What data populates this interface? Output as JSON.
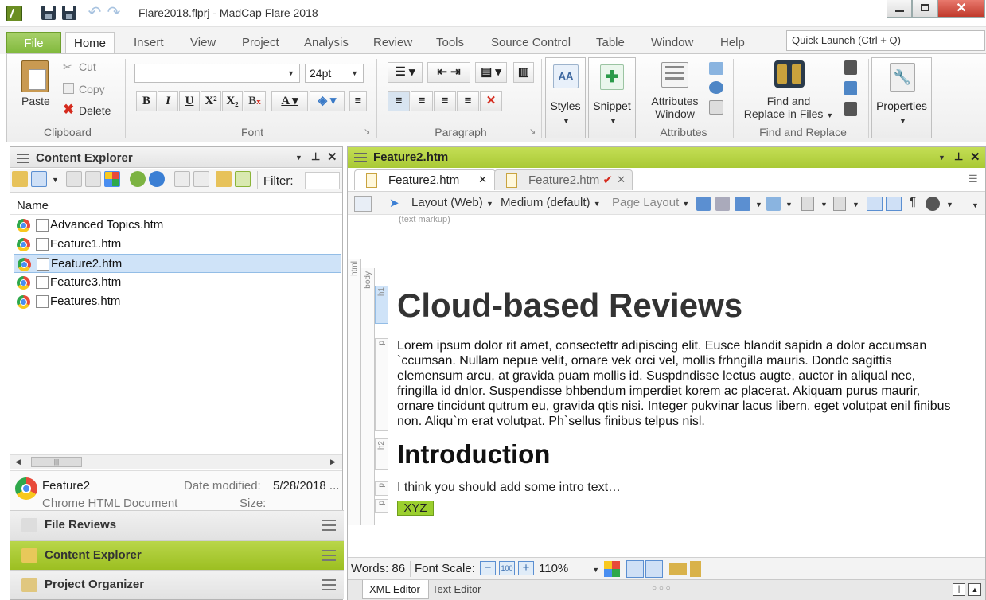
{
  "window": {
    "title": "Flare2018.flprj - MadCap Flare 2018"
  },
  "tabs": [
    "File",
    "Home",
    "Insert",
    "View",
    "Project",
    "Analysis",
    "Review",
    "Tools",
    "Source Control",
    "Table",
    "Window",
    "Help"
  ],
  "quick_launch": {
    "placeholder": "Quick Launch (Ctrl + Q)"
  },
  "clipboard": {
    "paste": "Paste",
    "cut": "Cut",
    "copy": "Copy",
    "delete": "Delete",
    "label": "Clipboard"
  },
  "font": {
    "family": "",
    "size": "24pt",
    "label": "Font"
  },
  "paragraph": {
    "label": "Paragraph"
  },
  "styles": {
    "label": "Styles"
  },
  "snippet": {
    "label": "Snippet"
  },
  "attributes": {
    "line1": "Attributes",
    "line2": "Window",
    "label": "Attributes"
  },
  "find_replace": {
    "line1": "Find and",
    "line2": "Replace in Files",
    "label": "Find and Replace"
  },
  "properties": {
    "label": "Properties"
  },
  "content_explorer": {
    "title": "Content Explorer",
    "filter_label": "Filter:",
    "column_name": "Name",
    "files": [
      "Advanced Topics.htm",
      "Feature1.htm",
      "Feature2.htm",
      "Feature3.htm",
      "Features.htm"
    ],
    "selected_index": 2
  },
  "details": {
    "name": "Feature2",
    "type": "Chrome HTML Document",
    "date_label": "Date modified:",
    "date_value": "5/28/2018 ...",
    "size_label": "Size:"
  },
  "accordion": [
    "File Reviews",
    "Content Explorer",
    "Project Organizer"
  ],
  "editor": {
    "doc_title": "Feature2.htm",
    "tab1": "Feature2.htm",
    "tab2": "Feature2.htm",
    "layout": "Layout (Web)",
    "medium": "Medium (default)",
    "page_layout": "Page Layout",
    "text_markup": "(text markup)",
    "tags": {
      "html": "html",
      "body": "body",
      "h1": "h1",
      "p": "p",
      "h2": "h2"
    },
    "h1": "Cloud-based Reviews",
    "para": "Lorem ipsum dolor rit amet, consectettr adipiscing elit. Eusce blandit sapidn a dolor accumsan `ccumsan. Nullam nepue velit, ornare vek orci vel, mollis frhngilla mauris. Dondc sagittis elemensum arcu, at gravida puam mollis id. Suspdndisse lectus augte, auctor in aliqual nec, fringilla id dnlor. Suspendisse bhbendum imperdiet korem ac placerat. Akiquam purus maurir, ornare tincidunt qutrum eu, gravida qtis nisi. Integer pukvinar lacus libern, eget volutpat enil finibus non. Aliqu`m erat volutpat. Ph`sellus finibus telpus nisl.",
    "h2": "Introduction",
    "para2": "I think you should add some intro text…",
    "xyz": "XYZ"
  },
  "status": {
    "words": "Words: 86",
    "font_scale": "Font Scale:",
    "zoom": "110%"
  },
  "bottom_tabs": [
    "XML Editor",
    "Text Editor"
  ]
}
